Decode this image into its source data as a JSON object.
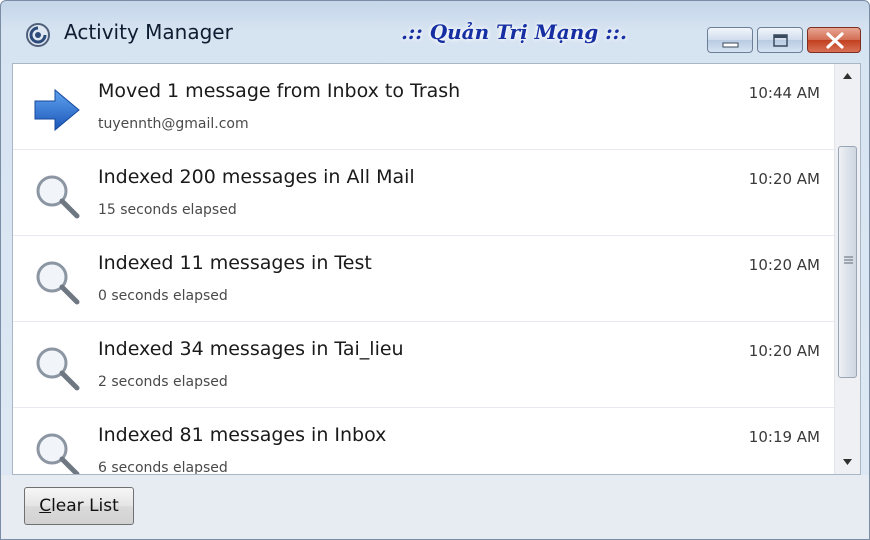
{
  "window": {
    "title": "Activity Manager",
    "watermark": ".:: Quản Trị Mạng ::.",
    "controls": [
      "minimize",
      "maximize",
      "close"
    ]
  },
  "activities": [
    {
      "icon": "arrow-right-icon",
      "title": "Moved 1 message from Inbox to Trash",
      "subtitle": "tuyennth@gmail.com",
      "time": "10:44 AM"
    },
    {
      "icon": "magnifier-icon",
      "title": "Indexed 200 messages in All Mail",
      "subtitle": "15 seconds elapsed",
      "time": "10:20 AM"
    },
    {
      "icon": "magnifier-icon",
      "title": "Indexed 11 messages in Test",
      "subtitle": "0 seconds elapsed",
      "time": "10:20 AM"
    },
    {
      "icon": "magnifier-icon",
      "title": "Indexed 34 messages in Tai_lieu",
      "subtitle": "2 seconds elapsed",
      "time": "10:20 AM"
    },
    {
      "icon": "magnifier-icon",
      "title": "Indexed 81 messages in Inbox",
      "subtitle": "6 seconds elapsed",
      "time": "10:19 AM"
    }
  ],
  "footer": {
    "clear_button": {
      "access_key": "C",
      "rest": "lear List"
    }
  },
  "colors": {
    "arrow": "#1f66c9",
    "watermark": "#162fa3",
    "close_button": "#c1401f"
  }
}
